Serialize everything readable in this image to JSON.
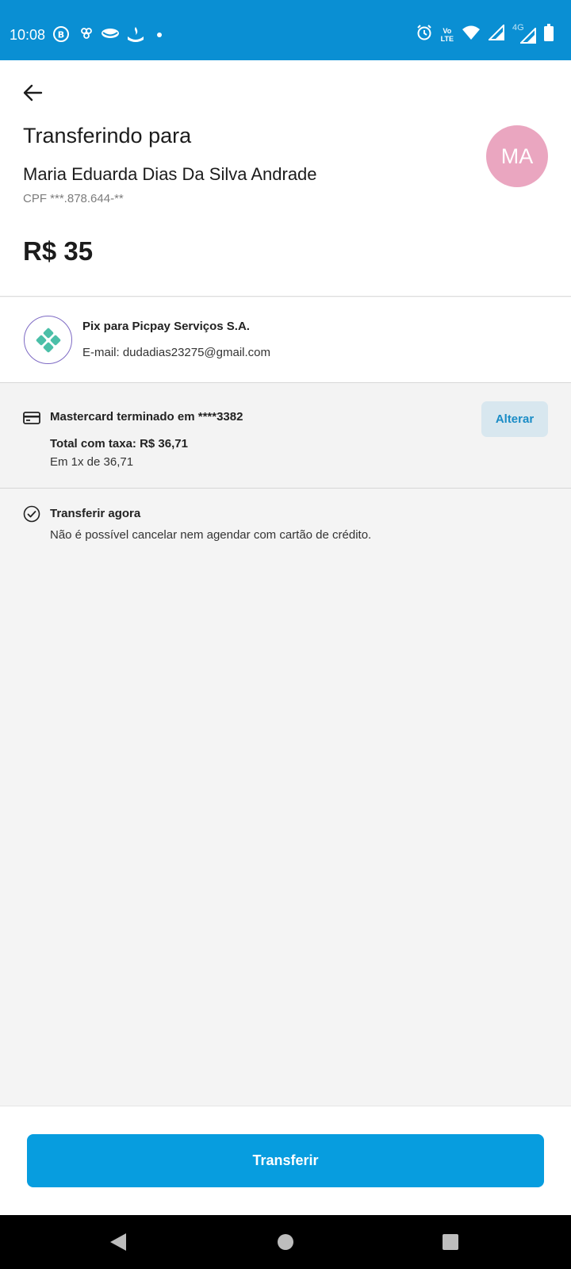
{
  "status_bar": {
    "time": "10:08",
    "left_icons": [
      "b-badge-icon",
      "link-icon",
      "cloud-icon",
      "bank-flame-icon",
      "dot-icon"
    ],
    "right_icons": [
      "alarm-icon",
      "volte-icon",
      "wifi-icon",
      "signal-icon",
      "signal-4g-icon",
      "battery-icon"
    ],
    "volte_label_top": "Vo",
    "volte_label_bottom": "LTE",
    "network_label": "4G"
  },
  "header": {
    "back_icon": "arrow-left-icon",
    "title": "Transferindo para",
    "recipient_name": "Maria Eduarda Dias Da Silva Andrade",
    "recipient_doc": "CPF ***.878.644-**",
    "amount": "R$ 35",
    "avatar_initials": "MA"
  },
  "pix": {
    "icon": "pix-icon",
    "title": "Pix para Picpay Serviços S.A.",
    "email": "E-mail: dudadias23275@gmail.com"
  },
  "payment": {
    "icon": "credit-card-icon",
    "card_label": "Mastercard terminado em ****3382",
    "total_label": "Total com taxa: R$ 36,71",
    "installments": "Em 1x de 36,71",
    "change_button": "Alterar"
  },
  "transfer_option": {
    "icon": "check-circle-icon",
    "title": "Transferir agora",
    "description": "Não é possível cancelar nem agendar com cartão de crédito."
  },
  "footer": {
    "submit_button": "Transferir"
  },
  "nav": {
    "back": "nav-back-icon",
    "home": "nav-home-icon",
    "recents": "nav-recents-icon"
  },
  "colors": {
    "status_bar": "#0a8fd3",
    "primary_button": "#079ddf",
    "avatar": "#eaa6c0",
    "pix_green": "#4bbfa8",
    "pix_ring": "#7e6ac4",
    "secondary_button_bg": "#d8e7ef",
    "secondary_button_text": "#1a8cc6"
  }
}
